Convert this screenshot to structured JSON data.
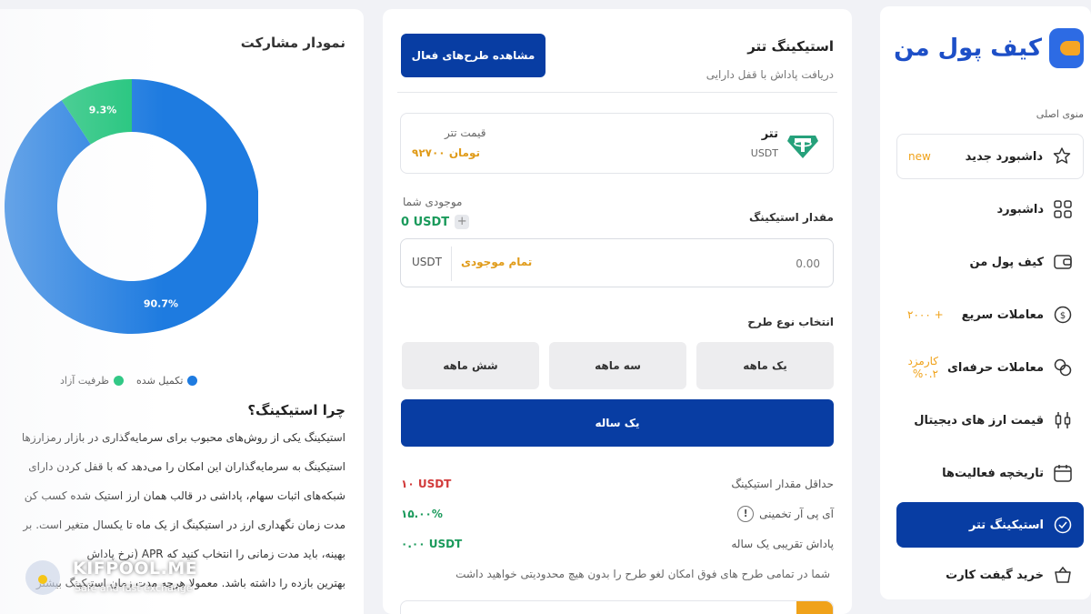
{
  "sidebar": {
    "logo_text": "کیف پول من",
    "menu_caption": "منوی اصلی",
    "items": [
      {
        "label": "داشبورد جدید",
        "extra": "new",
        "icon": "star-shield-icon"
      },
      {
        "label": "داشبورد",
        "extra": "",
        "icon": "grid-icon"
      },
      {
        "label": "کیف پول من",
        "extra": "",
        "icon": "wallet-icon"
      },
      {
        "label": "معاملات سریع",
        "extra": "+ ۲۰۰۰",
        "icon": "dollar-arrows-icon"
      },
      {
        "label": "معاملات حرفه‌ای",
        "extra": "کارمزد ۰.۲%",
        "icon": "exchange-icon"
      },
      {
        "label": "قیمت ارز های دیجیتال",
        "extra": "",
        "icon": "candles-icon"
      },
      {
        "label": "تاریخچه فعالیت‌ها",
        "extra": "",
        "icon": "calendar-icon"
      },
      {
        "label": "استیکینگ تتر",
        "extra": "",
        "icon": "staking-icon"
      },
      {
        "label": "خرید گیفت کارت",
        "extra": "",
        "icon": "basket-icon"
      }
    ]
  },
  "staking": {
    "title": "استیکینگ تتر",
    "subtitle": "دریافت پاداش با قفل دارایی",
    "active_plans_button": "مشاهده طرح‌های فعال",
    "coin_name": "تتر",
    "coin_symbol": "USDT",
    "price_label": "قیمت تتر",
    "price_value": "۹۲۷۰۰ تومان",
    "balance_label": "موجودی شما",
    "balance_value": "0 USDT",
    "amount_label": "مقدار استیکینگ",
    "amount_value": "0.00",
    "amount_unit": "USDT",
    "all_balance": "تمام موجودی",
    "plan_label": "انتخاب نوع طرح",
    "plans": [
      "یک ماهه",
      "سه ماهه",
      "شش ماهه",
      "یک ساله"
    ],
    "info": [
      {
        "label": "حداقل مقدار استیکینگ",
        "value": "۱۰ USDT",
        "color": "#d23b3b"
      },
      {
        "label": "آی پی آر تخمینی",
        "value": "۱۵.۰۰%",
        "color": "#1a9a5b"
      },
      {
        "label": "پاداش تقریبی یک ساله",
        "value": "۰.۰۰ USDT",
        "color": "#1a9a5b"
      }
    ],
    "note": "شما در تمامی طرح های فوق امکان لغو طرح را بدون هیچ محدودیتی خواهید داشت"
  },
  "chart_panel": {
    "title": "نمودار مشارکت",
    "why_title": "چرا استیکینگ؟",
    "why_lines": [
      "استیکینگ یکی از روش‌های محبوب برای سرمایه‌گذاری در بازار رمزارزها",
      "استیکینگ به سرمایه‌گذاران این امکان را می‌دهد که با قفل کردن دارای",
      "شبکه‌های اثبات سهام، پاداشی در قالب همان ارز استیک شده کسب کن",
      "مدت زمان نگهداری ارز در استیکینگ از یک ماه تا یکسال متغیر است. بر",
      "بهینه، باید مدت زمانی را انتخاب کنید که APR (نرخ پاداش",
      "بهترین بازده را داشته باشد. معمولا هرچه مدت زمان استیکینگ بیشتر"
    ]
  },
  "chart_data": {
    "type": "pie",
    "categories": [
      "تکمیل شده",
      "ظرفیت آزاد"
    ],
    "values": [
      90.7,
      9.3
    ],
    "labels": [
      "90.7%",
      "9.3%"
    ],
    "colors": [
      "#1e7be0",
      "#1ec47a"
    ],
    "legend_position": "bottom"
  },
  "watermark": {
    "name": "KIFPOOL.ME",
    "tagline": "Safe and fast exchange"
  }
}
